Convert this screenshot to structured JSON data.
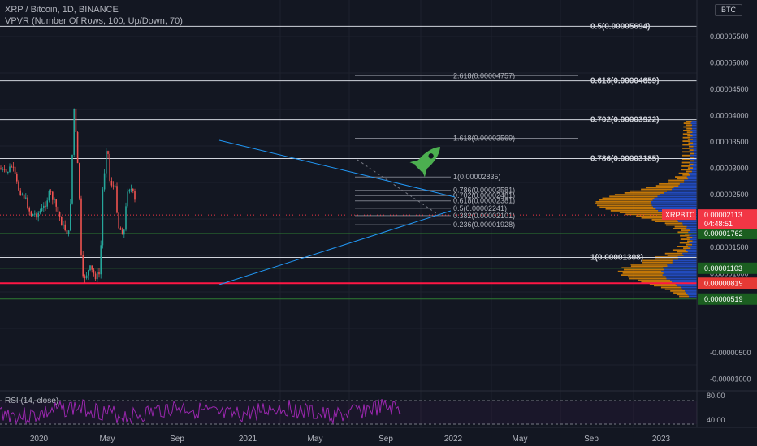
{
  "header": {
    "title": "XRP / Bitcoin, 1D, BINANCE",
    "indicator": "VPVR (Number Of Rows, 100, Up/Down, 70)",
    "rsi_label": "RSI (14, close)",
    "axis_unit": "BTC"
  },
  "chart_data": {
    "type": "candlestick",
    "symbol": "XRPBTC",
    "price_axis": {
      "range": [
        -1.45e-05,
        5.8e-06
      ],
      "ticks": [
        "0.00005500",
        "0.00005000",
        "0.00004500",
        "0.00004000",
        "0.00003500",
        "0.00003000",
        "0.00002500",
        "0.00001500",
        "0.00001000",
        "0.00000500",
        "-0.00000500",
        "-0.00001000"
      ]
    },
    "time_axis": [
      "2020",
      "May",
      "Sep",
      "2021",
      "May",
      "Sep",
      "2022",
      "May",
      "Sep",
      "2023"
    ],
    "close_series": [
      [
        "2019-12-01",
        3e-05
      ],
      [
        "2020-01-01",
        2.9e-05
      ],
      [
        "2020-02-01",
        3.05e-05
      ],
      [
        "2020-03-01",
        2.62e-05
      ],
      [
        "2020-04-01",
        2.45e-05
      ],
      [
        "2020-05-01",
        2.12e-05
      ],
      [
        "2020-06-01",
        2.13e-05
      ],
      [
        "2020-07-01",
        2.25e-05
      ],
      [
        "2020-08-01",
        2.55e-05
      ],
      [
        "2020-09-01",
        2.25e-05
      ],
      [
        "2020-10-01",
        1.9e-05
      ],
      [
        "2020-11-01",
        1.75e-05
      ],
      [
        "2020-11-25",
        4.2e-05
      ],
      [
        "2020-12-20",
        2.45e-05
      ],
      [
        "2021-01-01",
        8.5e-06
      ],
      [
        "2021-01-15",
        9.5e-06
      ],
      [
        "2021-02-10",
        1.1e-05
      ],
      [
        "2021-03-05",
        9.5e-06
      ],
      [
        "2021-03-30",
        1e-05
      ],
      [
        "2021-04-05",
        2.1e-05
      ],
      [
        "2021-04-14",
        2.9e-05
      ],
      [
        "2021-04-25",
        3e-05
      ],
      [
        "2021-05-01",
        3.9e-05
      ],
      [
        "2021-05-10",
        2.8e-05
      ],
      [
        "2021-05-25",
        2.7e-05
      ],
      [
        "2021-06-10",
        2.6e-05
      ],
      [
        "2021-06-25",
        1.9e-05
      ],
      [
        "2021-07-10",
        1.8e-05
      ],
      [
        "2021-07-25",
        1.82e-05
      ],
      [
        "2021-08-05",
        2.6e-05
      ],
      [
        "2021-08-20",
        2.65e-05
      ],
      [
        "2021-09-05",
        2.5e-05
      ],
      [
        "2021-09-20",
        2.21e-05
      ]
    ],
    "horizontal_levels": [
      {
        "label": "0.5(0.00005694)",
        "value": 5.694e-05
      },
      {
        "label": "0.618(0.00004659)",
        "value": 4.659e-05
      },
      {
        "label": "0.702(0.00003922)",
        "value": 3.922e-05
      },
      {
        "label": "0.786(0.00003185)",
        "value": 3.185e-05
      },
      {
        "label": "1(0.00001308)",
        "value": 1.308e-05
      }
    ],
    "fib_extension_levels": [
      {
        "label": "2.618(0.00004757)",
        "value": 4.757e-05
      },
      {
        "label": "1.618(0.00003569)",
        "value": 3.569e-05
      }
    ],
    "fib_retracement_levels": [
      {
        "label": "1(0.00002835)",
        "value": 2.835e-05
      },
      {
        "label": "0.786(0.00002581)",
        "value": 2.581e-05
      },
      {
        "label": "0.702(0.00002481)",
        "value": 2.481e-05
      },
      {
        "label": "0.618(0.00002381)",
        "value": 2.381e-05
      },
      {
        "label": "0.5(0.00002241)",
        "value": 2.241e-05
      },
      {
        "label": "0.382(0.00002101)",
        "value": 2.101e-05
      },
      {
        "label": "0.236(0.00001928)",
        "value": 1.928e-05
      }
    ],
    "price_badges": [
      {
        "label": "0.00001762",
        "value": 1.762e-05,
        "color": "#1b5e20"
      },
      {
        "label": "0.00001103",
        "value": 1.103e-05,
        "color": "#1b5e20"
      },
      {
        "label": "0.00000819",
        "value": 8.19e-06,
        "color": "#e53935"
      },
      {
        "label": "0.00000519",
        "value": 5.19e-06,
        "color": "#1b5e20"
      }
    ],
    "last_price": {
      "symbol": "XRPBTC",
      "price": "0.00002113",
      "countdown": "04:48:51",
      "value": 2.113e-05,
      "color": "#f23645"
    },
    "rsi": {
      "levels": [
        "80.00",
        "40.00"
      ]
    },
    "colors": {
      "candle_up": "#26a69a",
      "candle_down": "#ef5350",
      "trendline": "#2196f3",
      "rsi": "#9c27b0",
      "vpvr_up": "#2962ff",
      "vpvr_down": "#ff9800",
      "rocket": "#4caf50",
      "support": "#ff1744"
    }
  }
}
